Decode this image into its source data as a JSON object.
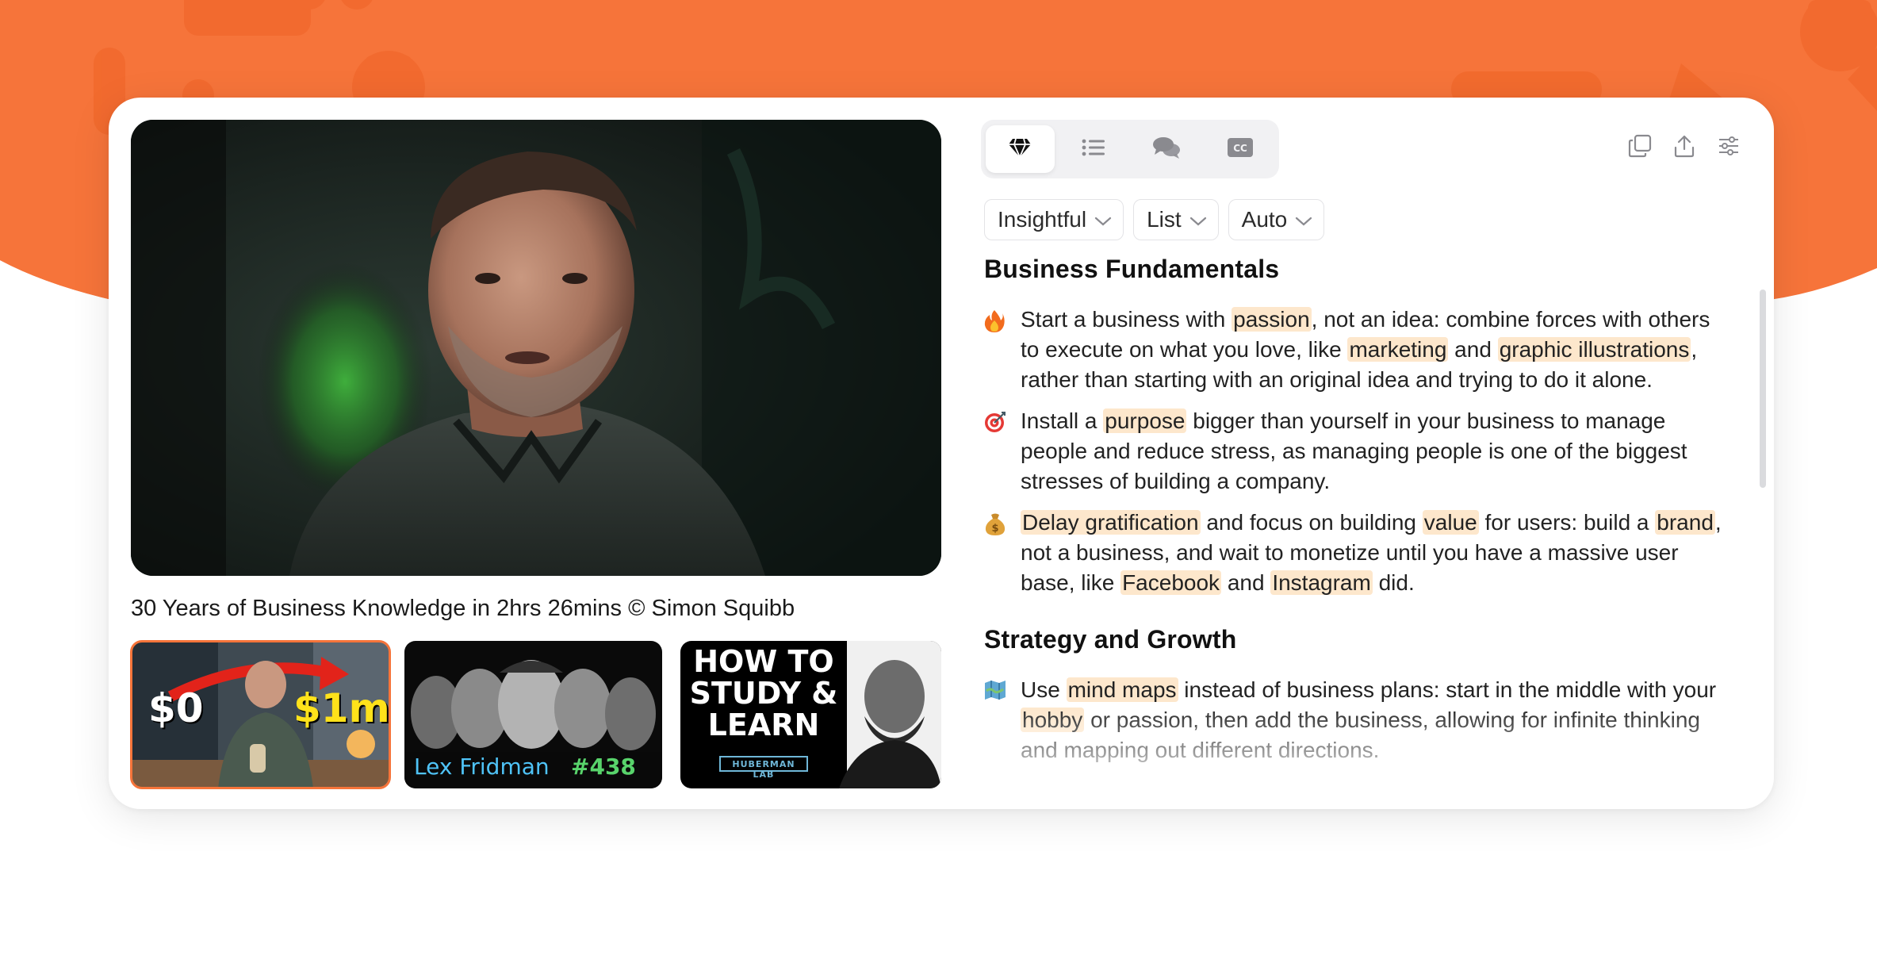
{
  "video": {
    "title": "30 Years of Business Knowledge in 2hrs 26mins © Simon Squibb"
  },
  "thumbnails": [
    {
      "id": "simon",
      "selected": true,
      "text_left": "$0",
      "text_right": "$1m"
    },
    {
      "id": "lex",
      "selected": false,
      "text_left": "Lex Fridman",
      "text_right": "#438"
    },
    {
      "id": "huberman",
      "selected": false,
      "text_main_1": "HOW TO",
      "text_main_2": "STUDY &",
      "text_main_3": "LEARN",
      "text_sub": "HUBERMAN LAB"
    }
  ],
  "tabs": [
    {
      "icon": "diamond-icon",
      "active": true
    },
    {
      "icon": "list-icon",
      "active": false
    },
    {
      "icon": "chat-icon",
      "active": false
    },
    {
      "icon": "cc-icon",
      "active": false
    }
  ],
  "actions": [
    {
      "icon": "copy-icon"
    },
    {
      "icon": "share-icon"
    },
    {
      "icon": "settings-sliders-icon"
    }
  ],
  "filters": {
    "style": "Insightful",
    "format": "List",
    "language": "Auto"
  },
  "sections": [
    {
      "title": "Business Fundamentals",
      "bullets": [
        {
          "emoji": "fire",
          "segments": [
            {
              "t": "Start a business with "
            },
            {
              "t": "passion",
              "h": true
            },
            {
              "t": ", not an idea: combine forces with others to execute on what you love, like "
            },
            {
              "t": "marketing",
              "h": true
            },
            {
              "t": " and "
            },
            {
              "t": "graphic illustrations",
              "h": true
            },
            {
              "t": ", rather than starting with an original idea and trying to do it alone."
            }
          ]
        },
        {
          "emoji": "target",
          "segments": [
            {
              "t": "Install a "
            },
            {
              "t": "purpose",
              "h": true
            },
            {
              "t": " bigger than yourself in your business to manage people and reduce stress, as managing people is one of the biggest stresses of building a company."
            }
          ]
        },
        {
          "emoji": "money-bag",
          "segments": [
            {
              "t": "Delay gratification",
              "h": true
            },
            {
              "t": " and focus on building "
            },
            {
              "t": "value",
              "h": true
            },
            {
              "t": " for users: build a "
            },
            {
              "t": "brand",
              "h": true
            },
            {
              "t": ", not a business, and wait to monetize until you have a massive user base, like "
            },
            {
              "t": "Facebook",
              "h": true
            },
            {
              "t": " and "
            },
            {
              "t": "Instagram",
              "h": true
            },
            {
              "t": " did."
            }
          ]
        }
      ]
    },
    {
      "title": "Strategy and Growth",
      "bullets": [
        {
          "emoji": "map",
          "segments": [
            {
              "t": "Use "
            },
            {
              "t": "mind maps",
              "h": true
            },
            {
              "t": " instead of business plans: start in the middle with your "
            },
            {
              "t": "hobby",
              "h": true
            },
            {
              "t": " or passion, then add the business, allowing for infinite thinking and mapping out different directions."
            }
          ]
        }
      ]
    }
  ],
  "colors": {
    "brand_orange": "#f6743a",
    "highlight": "#fde7cc"
  }
}
